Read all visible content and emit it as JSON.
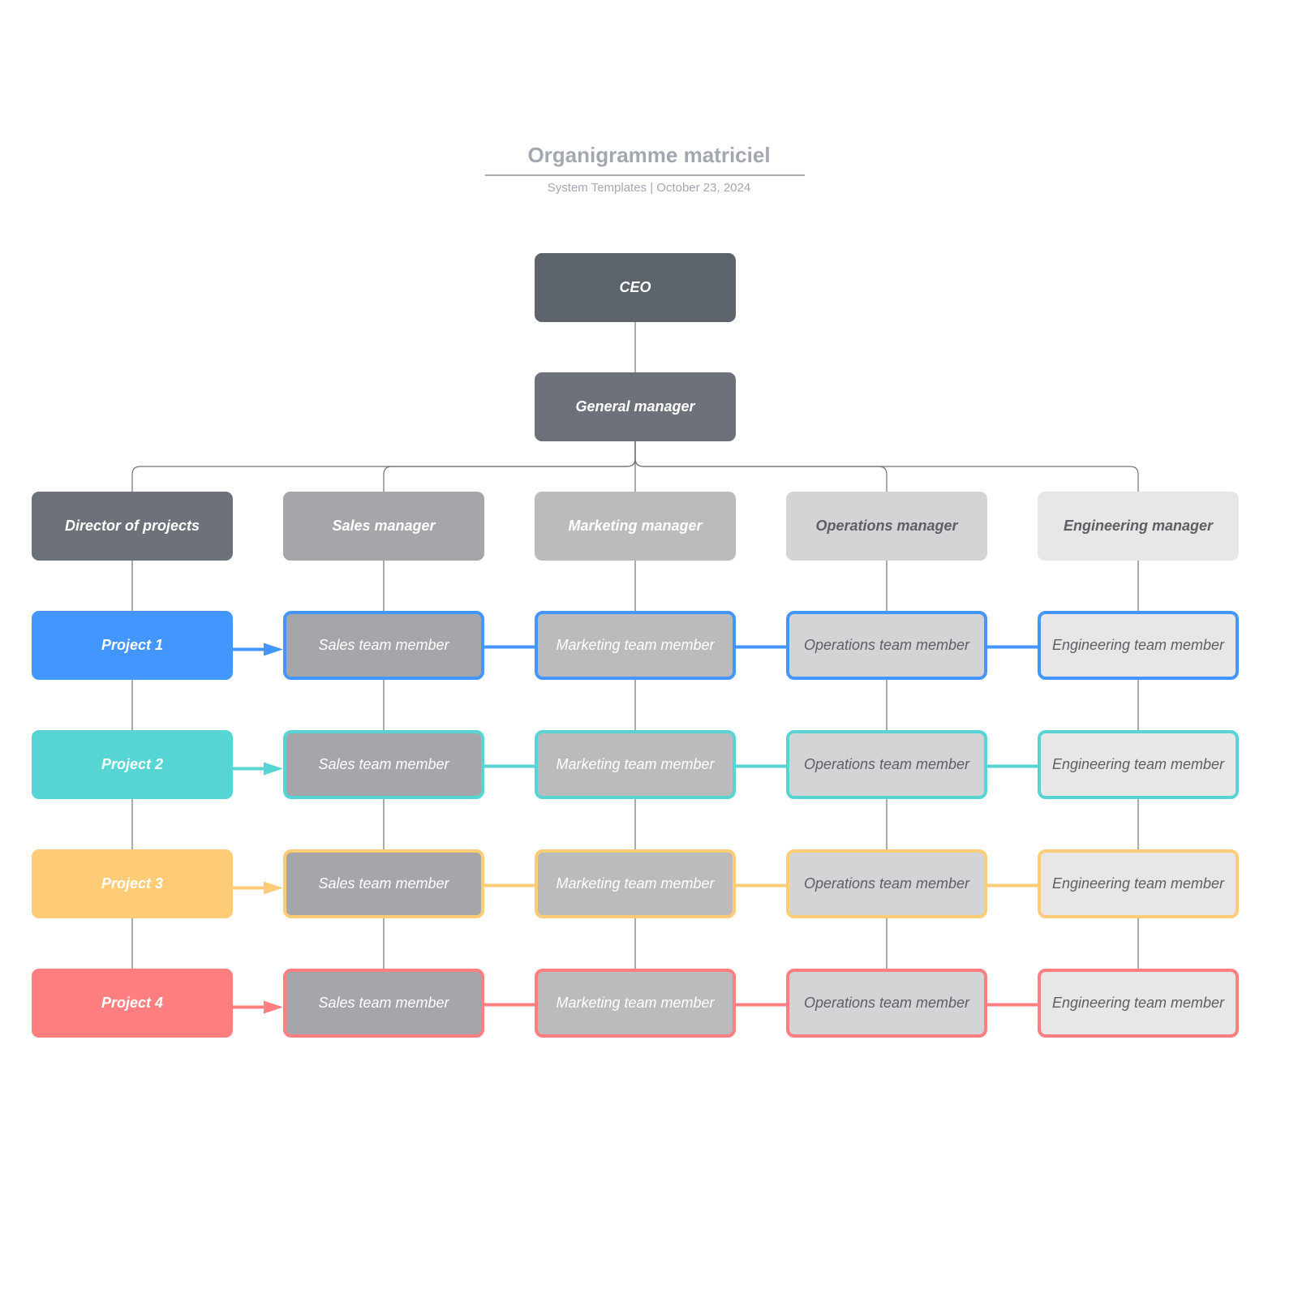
{
  "header": {
    "title": "Organigramme matriciel",
    "subtitle": "System Templates  |  October 23, 2024"
  },
  "top": {
    "ceo": {
      "label": "CEO",
      "fill": "#5d636b",
      "text_color": "#ffffff"
    },
    "gm": {
      "label": "General manager",
      "fill": "#6d727a",
      "text_color": "#ffffff"
    }
  },
  "managers": [
    {
      "label": "Director of projects",
      "fill": "#6d727a",
      "text_color": "#ffffff"
    },
    {
      "label": "Sales manager",
      "fill": "#a5a6a9",
      "text_color": "#ffffff"
    },
    {
      "label": "Marketing manager",
      "fill": "#bbbbbd",
      "text_color": "#ffffff"
    },
    {
      "label": "Operations manager",
      "fill": "#d3d4d6",
      "text_color": "#5d5f63"
    },
    {
      "label": "Engineering manager",
      "fill": "#e7e7e8",
      "text_color": "#5d5f63"
    }
  ],
  "projects": [
    {
      "label": "Project 1",
      "color": "#4496ff"
    },
    {
      "label": "Project 2",
      "color": "#57d5d5"
    },
    {
      "label": "Project 3",
      "color": "#fecb77"
    },
    {
      "label": "Project 4",
      "color": "#ff7f80"
    }
  ],
  "members": [
    {
      "label": "Sales team member",
      "fill": "#a5a6a9",
      "text_color": "#ffffff"
    },
    {
      "label": "Marketing team member",
      "fill": "#bbbbbd",
      "text_color": "#ffffff"
    },
    {
      "label": "Operations team member",
      "fill": "#d3d4d6",
      "text_color": "#5d5f63"
    },
    {
      "label": "Engineering team member",
      "fill": "#e7e7e8",
      "text_color": "#5d5f63"
    }
  ],
  "connector_color": "#707378"
}
